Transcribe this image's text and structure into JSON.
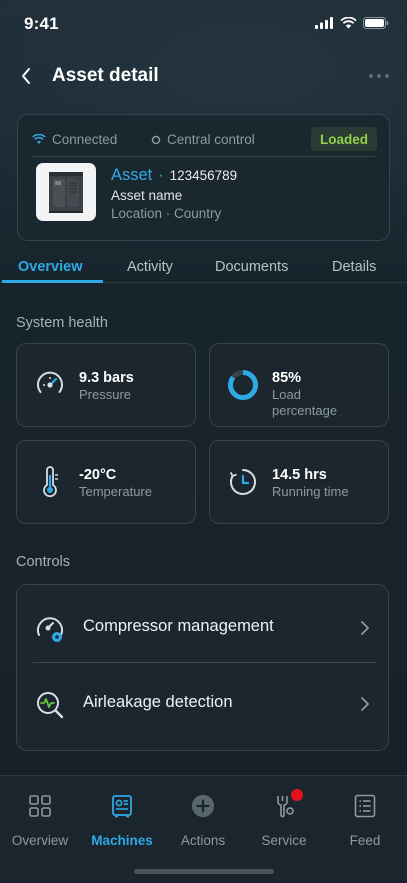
{
  "status_bar": {
    "time": "9:41"
  },
  "header": {
    "title": "Asset detail"
  },
  "asset_card": {
    "connection_status": "Connected",
    "control_mode": "Central control",
    "state_badge": "Loaded",
    "asset_type": "Asset",
    "separator": "·",
    "asset_number": "123456789",
    "asset_name": "Asset name",
    "location": "Location · Country"
  },
  "tabs": [
    {
      "label": "Overview",
      "active": true
    },
    {
      "label": "Activity",
      "active": false
    },
    {
      "label": "Documents",
      "active": false
    },
    {
      "label": "Details",
      "active": false
    }
  ],
  "system_health": {
    "title": "System health",
    "metrics": [
      {
        "value": "9.3 bars",
        "label": "Pressure",
        "icon": "pressure-gauge-icon"
      },
      {
        "value": "85%",
        "label": "Load percentage",
        "icon": "load-ring-icon",
        "fraction": 0.85
      },
      {
        "value": "-20°C",
        "label": "Temperature",
        "icon": "thermometer-icon"
      },
      {
        "value": "14.5 hrs",
        "label": "Running time",
        "icon": "running-time-icon"
      }
    ]
  },
  "controls": {
    "title": "Controls",
    "items": [
      {
        "label": "Compressor management",
        "icon": "compressor-management-icon"
      },
      {
        "label": "Airleakage detection",
        "icon": "airleakage-detection-icon"
      }
    ]
  },
  "bottom_nav": [
    {
      "label": "Overview",
      "icon": "grid-icon",
      "active": false
    },
    {
      "label": "Machines",
      "icon": "machine-icon",
      "active": true
    },
    {
      "label": "Actions",
      "icon": "plus-circle-icon",
      "active": false
    },
    {
      "label": "Service",
      "icon": "wrench-icon",
      "active": false,
      "notification": true
    },
    {
      "label": "Feed",
      "icon": "feed-icon",
      "active": false
    }
  ],
  "colors": {
    "accent": "#2fa9e5",
    "loaded_green": "#8fd14a",
    "notification_red": "#e3121b",
    "background": "#18232b"
  }
}
